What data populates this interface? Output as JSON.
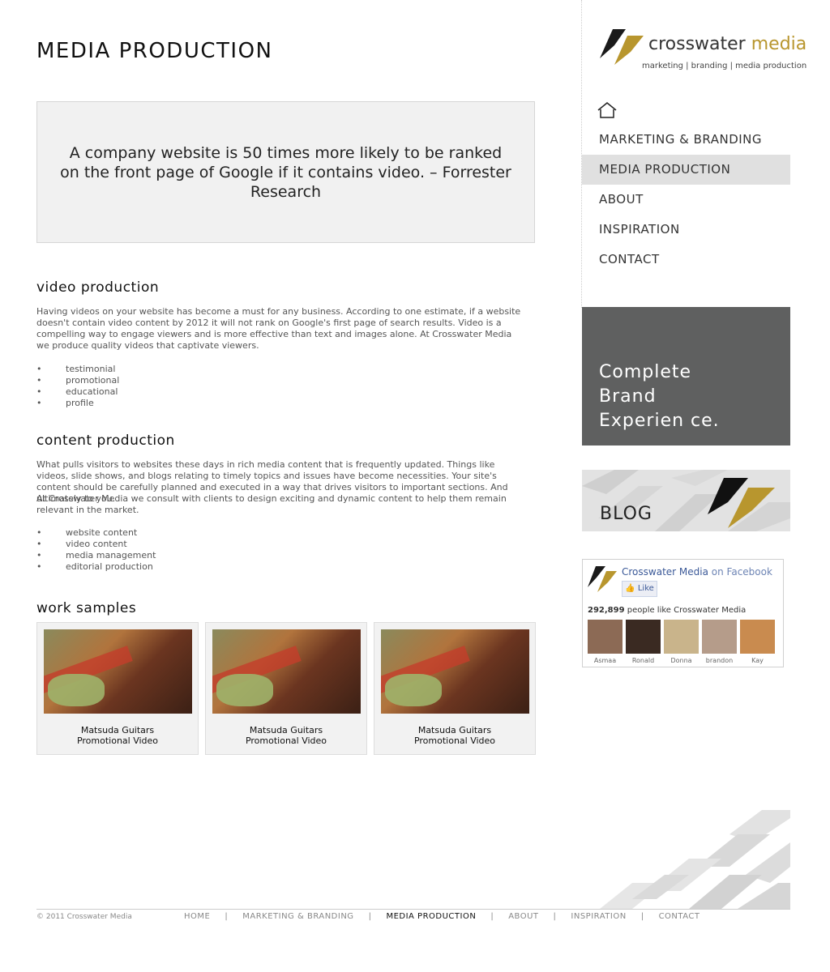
{
  "page": {
    "title": "MEDIA PRODUCTION",
    "quote": "A company website is 50 times more likely to be ranked on the front page of Google if it contains video. – Forrester Research"
  },
  "video": {
    "heading": "video production",
    "body": "Having videos on your website has become a must for any business. According to one estimate, if a website doesn't contain video content by 2012 it will not rank on Google's first page of search results. Video is a compelling way to engage viewers and is more effective than text and images alone. At Crosswater Media we produce quality videos that captivate viewers.",
    "items": [
      "testimonial",
      "promotional",
      "educational",
      "profile"
    ]
  },
  "content": {
    "heading": "content production",
    "body1": "What pulls visitors to websites these days in rich media content that is  frequently updated. Things like videos, slide shows, and blogs relating to timely topics and issues have become necessities. Your site's content should be carefully planned and executed in a way that drives visitors to important sections. And ultimately to you.",
    "body2": "At Crosswater Media we consult with clients to design exciting and dynamic content to help them remain relevant in the market.",
    "items": [
      "website content",
      "video content",
      "media management",
      "editorial production"
    ]
  },
  "samples": {
    "heading": "work samples",
    "cards": [
      {
        "line1": "Matsuda Guitars",
        "line2": "Promotional Video"
      },
      {
        "line1": "Matsuda Guitars",
        "line2": "Promotional Video"
      },
      {
        "line1": "Matsuda Guitars",
        "line2": "Promotional Video"
      }
    ]
  },
  "brand": {
    "logo_word1": "crosswater",
    "logo_word2": "media",
    "tagline": "marketing | branding | media production",
    "accent_color": "#b8962e"
  },
  "nav": {
    "items": [
      "MARKETING & BRANDING",
      "MEDIA PRODUCTION",
      "ABOUT",
      "INSPIRATION",
      "CONTACT"
    ],
    "active": "MEDIA PRODUCTION"
  },
  "promo": {
    "line1": "Complete",
    "line2": "Brand",
    "line3": "Experien ce."
  },
  "blog": {
    "label": "BLOG"
  },
  "facebook": {
    "page_name": "Crosswater Media",
    "on": "on Facebook",
    "like": "Like",
    "count": "292,899",
    "count_suffix": "people like",
    "count_page": "Crosswater Media",
    "fans": [
      "Asmaa",
      "Ronald",
      "Donna",
      "brandon",
      "Kay"
    ]
  },
  "footer": {
    "copyright": "© 2011 Crosswater Media",
    "links": [
      "HOME",
      "MARKETING & BRANDING",
      "MEDIA PRODUCTION",
      "ABOUT",
      "INSPIRATION",
      "CONTACT"
    ],
    "separator": "|"
  }
}
